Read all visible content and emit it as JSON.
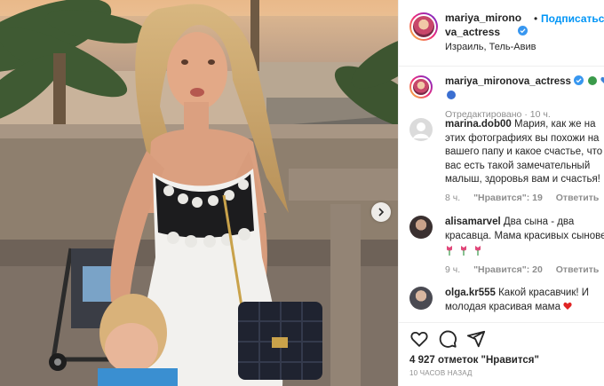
{
  "post": {
    "author": "mariya_mironova_actress",
    "author_line1": "mariya_mirono",
    "author_line2": "va_actress",
    "dot": "•",
    "follow_label": "Подписаться",
    "location": "Израиль, Тель-Авив"
  },
  "caption": {
    "username": "mariya_mironova_actress",
    "edited": "Отредактировано",
    "time": "10 ч."
  },
  "comments": [
    {
      "username": "marina.dob00",
      "text": "Мария, как же на этих фотографиях вы похожи на вашего папу и какое счастье, что у вас есть такой замечательный малыш, здоровья вам и счастья!",
      "time": "8 ч.",
      "likes": "\"Нравится\": 19",
      "reply": "Ответить"
    },
    {
      "username": "alisamarvel",
      "text": "Два сына - два красавца. Мама красивых сыновей",
      "time": "9 ч.",
      "likes": "\"Нравится\": 20",
      "reply": "Ответить"
    },
    {
      "username": "olga.kr555",
      "text": "Какой красавчик! И молодая красивая мама"
    }
  ],
  "stats": {
    "likes": "4 927 отметок \"Нравится\"",
    "time_ago": "10 ЧАСОВ НАЗАД"
  },
  "icons": {
    "like": "heart-icon",
    "comment": "comment-icon",
    "share": "share-icon",
    "verified": "verified-badge-icon",
    "next": "chevron-right-icon"
  },
  "colors": {
    "accent": "#0095f6",
    "muted": "#8e8e8e",
    "text": "#262626"
  }
}
